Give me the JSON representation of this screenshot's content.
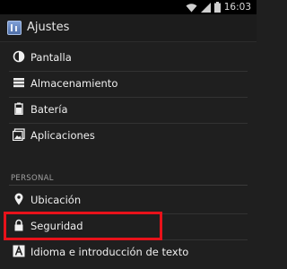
{
  "status_bar": {
    "time": "16:03",
    "icons": [
      "wifi-icon",
      "signal-icon",
      "battery-icon"
    ]
  },
  "action_bar": {
    "title": "Ajustes",
    "icon": "settings-app-icon"
  },
  "device_items": [
    {
      "label": "Pantalla",
      "icon": "brightness-icon"
    },
    {
      "label": "Almacenamiento",
      "icon": "storage-icon"
    },
    {
      "label": "Batería",
      "icon": "battery-icon"
    },
    {
      "label": "Aplicaciones",
      "icon": "apps-icon"
    }
  ],
  "personal_section": {
    "header": "PERSONAL",
    "items": [
      {
        "label": "Ubicación",
        "icon": "location-pin-icon"
      },
      {
        "label": "Seguridad",
        "icon": "lock-icon",
        "highlighted": true
      },
      {
        "label": "Idioma e introducción de texto",
        "icon": "language-icon"
      }
    ]
  },
  "colors": {
    "background": "#1f1f1f",
    "highlight": "#e8121a",
    "text": "#efefef",
    "section_text": "#a0a0a0"
  }
}
